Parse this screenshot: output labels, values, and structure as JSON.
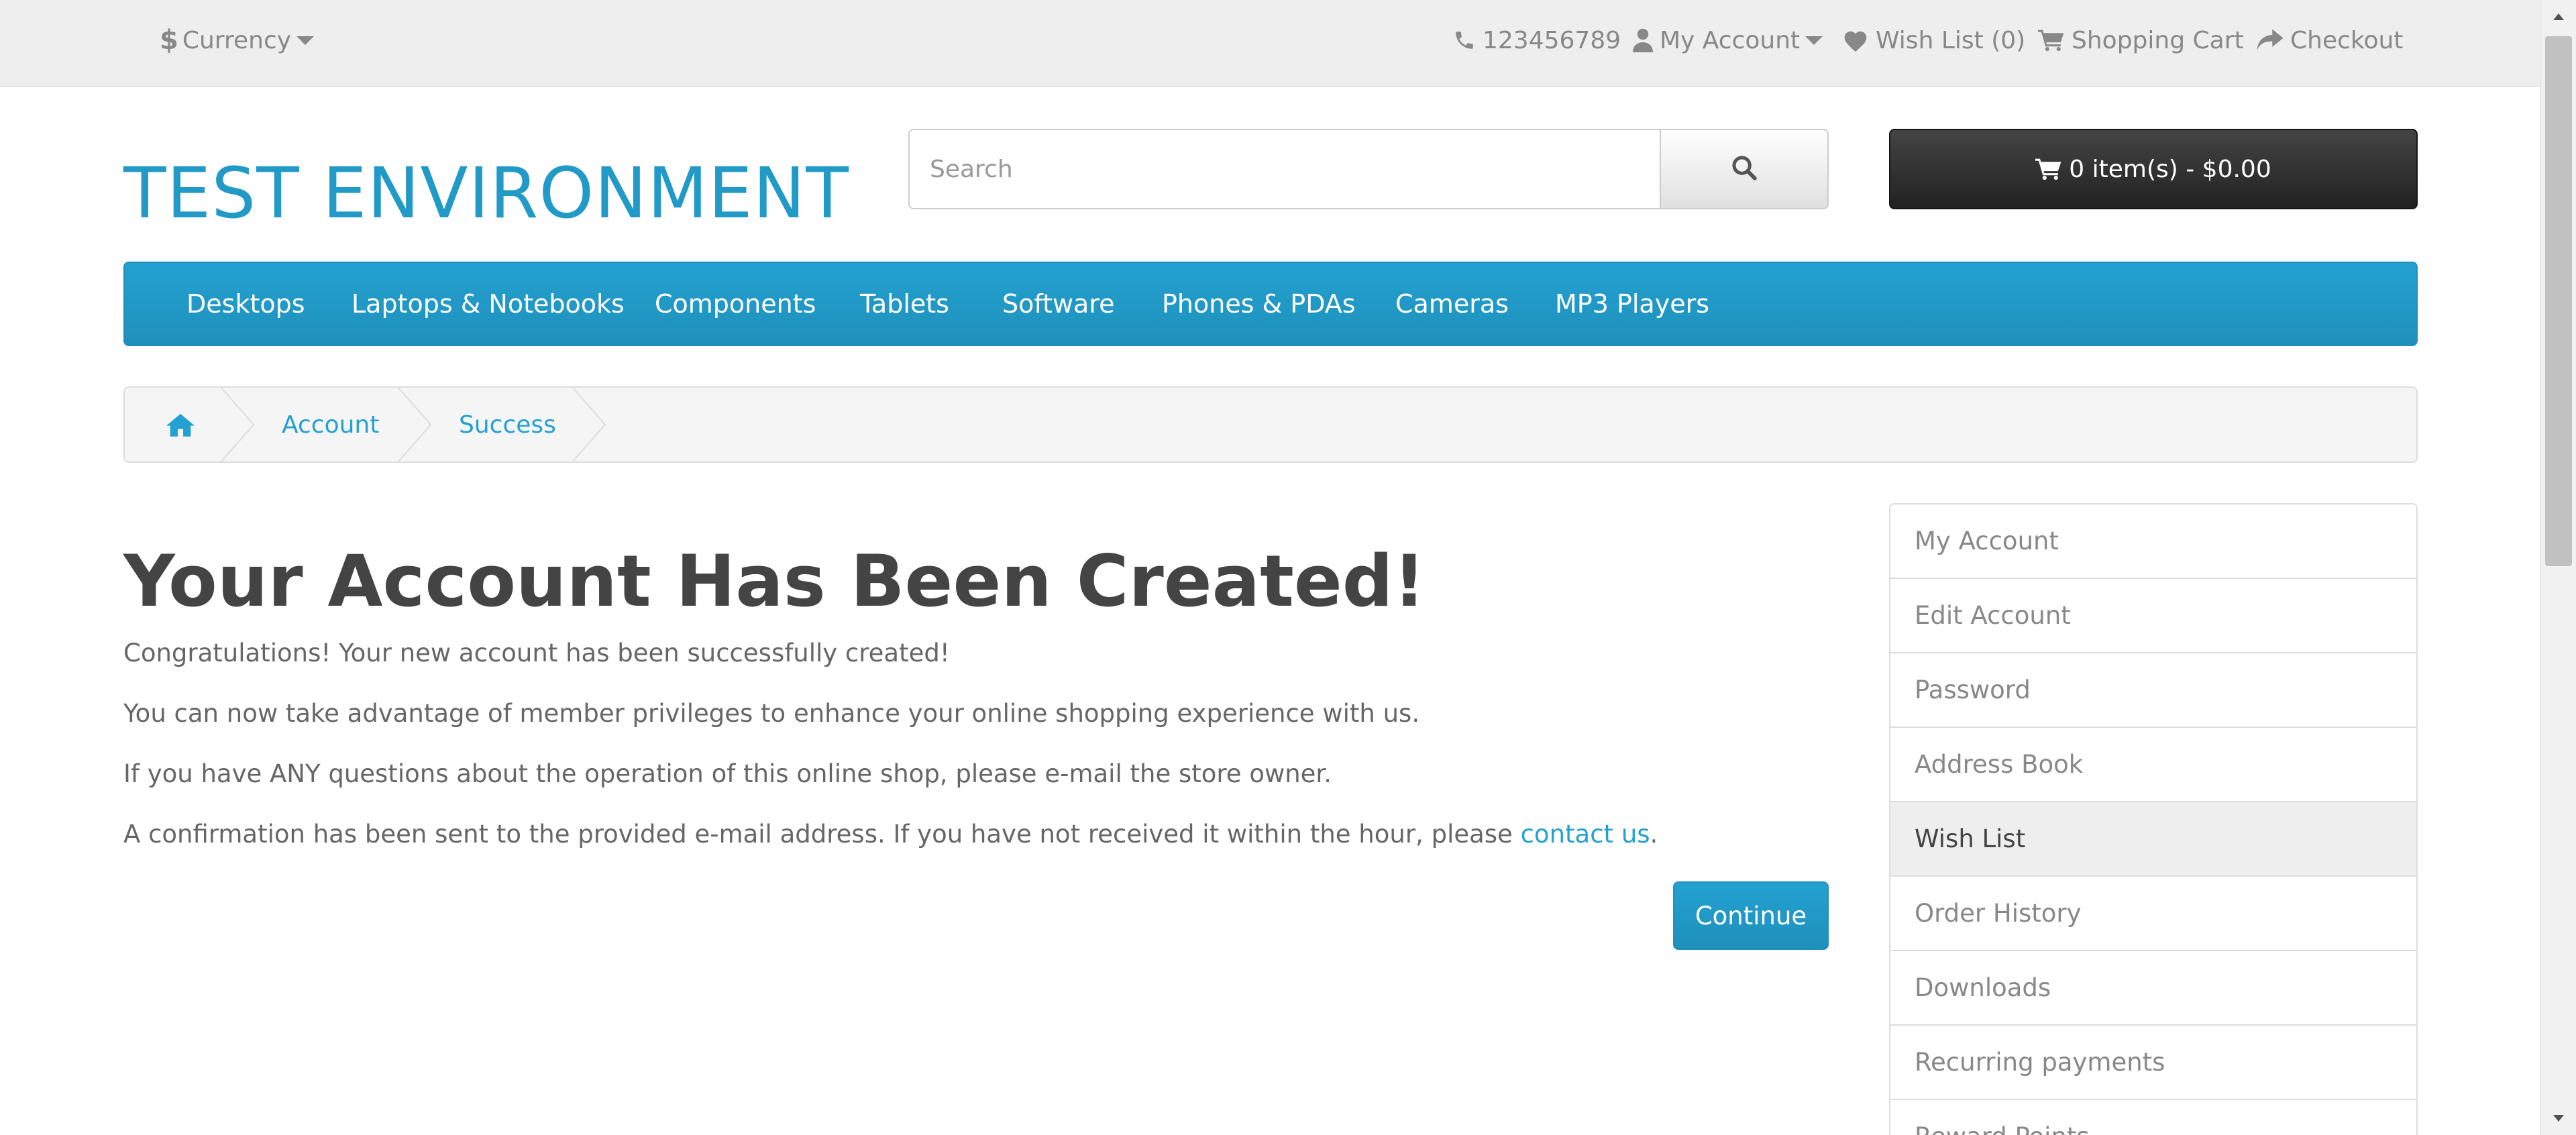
{
  "top_bar": {
    "currency_symbol": "$",
    "currency_label": "Currency",
    "phone": "123456789",
    "my_account": "My Account",
    "wish_list": "Wish List (0)",
    "shopping_cart": "Shopping Cart",
    "checkout": "Checkout"
  },
  "header": {
    "logo": "TEST ENVIRONMENT",
    "search_placeholder": "Search",
    "cart_button": "0 item(s) - $0.00"
  },
  "menu": {
    "items": [
      "Desktops",
      "Laptops & Notebooks",
      "Components",
      "Tablets",
      "Software",
      "Phones & PDAs",
      "Cameras",
      "MP3 Players"
    ]
  },
  "breadcrumb": {
    "items": [
      "Account",
      "Success"
    ]
  },
  "content": {
    "title": "Your Account Has Been Created!",
    "p1": "Congratulations! Your new account has been successfully created!",
    "p2": "You can now take advantage of member privileges to enhance your online shopping experience with us.",
    "p3": "If you have ANY questions about the operation of this online shop, please e-mail the store owner.",
    "p4_before": "A confirmation has been sent to the provided e-mail address. If you have not received it within the hour, please ",
    "p4_link": "contact us",
    "p4_after": ".",
    "continue_button": "Continue"
  },
  "sidebar": {
    "items": [
      "My Account",
      "Edit Account",
      "Password",
      "Address Book",
      "Wish List",
      "Order History",
      "Downloads",
      "Recurring payments",
      "Reward Points"
    ],
    "active_item": "Wish List"
  },
  "colors": {
    "brand_blue": "#229ac8",
    "top_bar_bg": "#eeeeee",
    "cart_button_bg": "#363636",
    "breadcrumb_bg": "#f5f5f5"
  },
  "icons": {
    "phone": "phone-icon",
    "user": "user-icon",
    "heart": "heart-icon",
    "cart": "shopping-cart-icon",
    "share": "share-icon",
    "search": "search-icon",
    "home": "home-icon"
  }
}
